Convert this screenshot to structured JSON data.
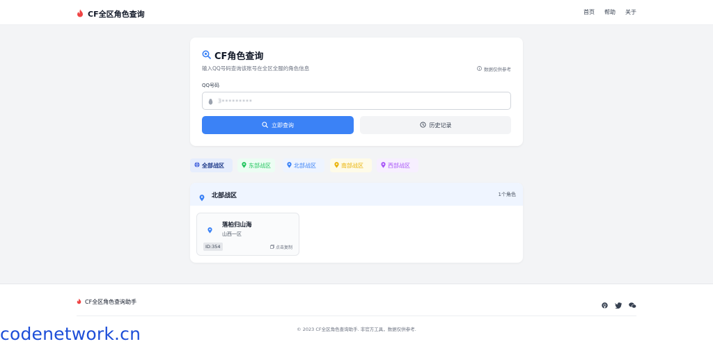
{
  "nav": {
    "brand": "CF全区角色查询",
    "links": [
      "首页",
      "帮助",
      "关于"
    ]
  },
  "search": {
    "title": "CF角色查询",
    "subtitle": "输入QQ号码查询该账号在全区全服的角色信息",
    "notice": "数据仅供参考",
    "qq_label": "QQ号码",
    "qq_value": "3•••••••••",
    "query_button": "立即查询",
    "history_button": "历史记录"
  },
  "zones": {
    "tabs": [
      {
        "label": "全部战区",
        "color": "#3b5bdb",
        "bg": "#e6edfd",
        "active": true
      },
      {
        "label": "东部战区",
        "color": "#22c55e",
        "bg": "#ecfdf3",
        "active": false
      },
      {
        "label": "北部战区",
        "color": "#3b82f6",
        "bg": "#eef4ff",
        "active": false
      },
      {
        "label": "南部战区",
        "color": "#eab308",
        "bg": "#fefbe8",
        "active": false
      },
      {
        "label": "西部战区",
        "color": "#a855f7",
        "bg": "#f7efff",
        "active": false
      }
    ]
  },
  "results": {
    "zone_name": "北部战区",
    "count": "1个角色",
    "characters": [
      {
        "name": "落柏归山海",
        "server": "山西一区",
        "id": "ID:354",
        "copy": "点击复制"
      }
    ]
  },
  "footer": {
    "brand": "CF全区角色查询助手",
    "copyright": "© 2023 CF全区角色查询助手. 非官方工具，数据仅供参考."
  },
  "watermark": "codenetwork.cn",
  "colors": {
    "accent": "#3b82f6",
    "flame": "#ef4444"
  }
}
